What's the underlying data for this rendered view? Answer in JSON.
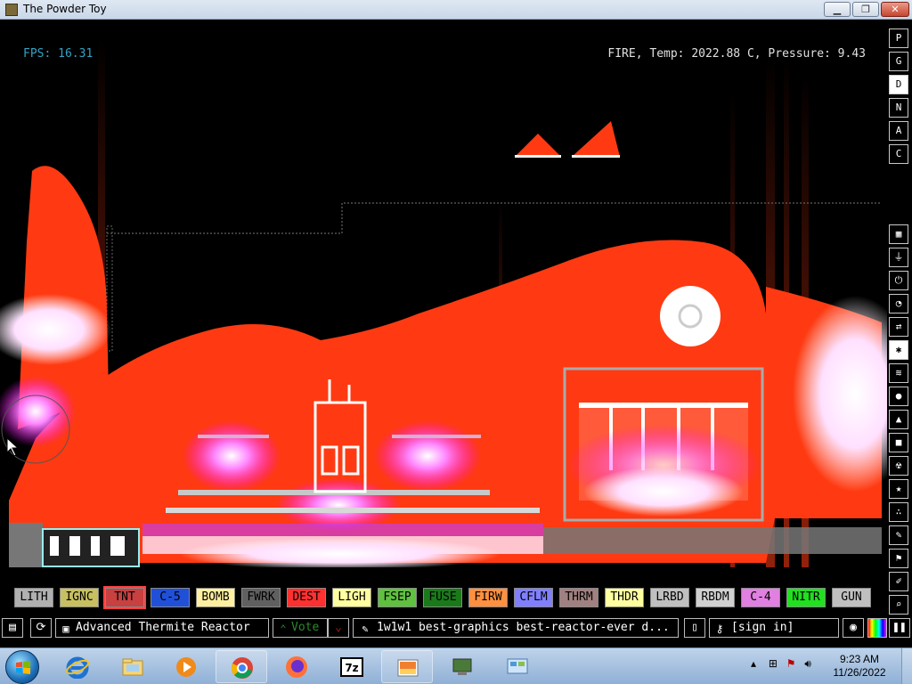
{
  "window": {
    "title": "The Powder Toy",
    "min": "▁",
    "max": "❐",
    "close": "✕"
  },
  "hud": {
    "fps": "FPS: 16.31",
    "info": "FIRE, Temp: 2022.88 C, Pressure: 9.43"
  },
  "sidebar": {
    "top": [
      "P",
      "G",
      "D",
      "N",
      "A",
      "C"
    ],
    "active_top": "D",
    "categories": [
      "wall-icon",
      "electronics-icon",
      "powered-icon",
      "sensor-icon",
      "force-icon",
      "explosives-icon",
      "gases-icon",
      "liquids-icon",
      "powders-icon",
      "solids-icon",
      "radioactive-icon",
      "special-icon",
      "life-icon",
      "tools-icon",
      "favorites-icon",
      "decoration-icon",
      "pause-icon",
      "search-icon"
    ]
  },
  "elements": [
    {
      "label": "LITH",
      "bg": "#b0b0b0"
    },
    {
      "label": "IGNC",
      "bg": "#c8c060"
    },
    {
      "label": "TNT",
      "bg": "#c84040"
    },
    {
      "label": "C-5",
      "bg": "#2050d8"
    },
    {
      "label": "BOMB",
      "bg": "#fff0a0"
    },
    {
      "label": "FWRK",
      "bg": "#606060"
    },
    {
      "label": "DEST",
      "bg": "#ff3030"
    },
    {
      "label": "LIGH",
      "bg": "#ffffa0"
    },
    {
      "label": "FSEP",
      "bg": "#60c040"
    },
    {
      "label": "FUSE",
      "bg": "#1a7a1a"
    },
    {
      "label": "FIRW",
      "bg": "#ff9040"
    },
    {
      "label": "CFLM",
      "bg": "#8080ff"
    },
    {
      "label": "THRM",
      "bg": "#a08080"
    },
    {
      "label": "THDR",
      "bg": "#ffffa0"
    },
    {
      "label": "LRBD",
      "bg": "#c0c0c0"
    },
    {
      "label": "RBDM",
      "bg": "#d0d0d0"
    },
    {
      "label": "C-4",
      "bg": "#e080e0"
    },
    {
      "label": "NITR",
      "bg": "#20e020"
    },
    {
      "label": "GUN",
      "bg": "#c0c0c0"
    }
  ],
  "selected_element": "TNT",
  "bottom": {
    "open": "open-icon",
    "reload": "reload-icon",
    "save_name": "Advanced Thermite Reactor",
    "vote": "Vote",
    "tags": "1w1w1 best-graphics best-reactor-ever d...",
    "new": "new-icon",
    "login": "[sign in]"
  },
  "taskbar": {
    "apps": [
      "internet-explorer-icon",
      "file-explorer-icon",
      "media-player-icon",
      "chrome-icon",
      "firefox-icon",
      "7zip-icon",
      "powder-toy-icon",
      "network-app-icon",
      "control-panel-icon"
    ],
    "time": "9:23 AM",
    "date": "11/26/2022"
  },
  "colors": {
    "fire": "#ff3a12",
    "glow": "#ff66ff",
    "fps": "#33a3c6"
  }
}
